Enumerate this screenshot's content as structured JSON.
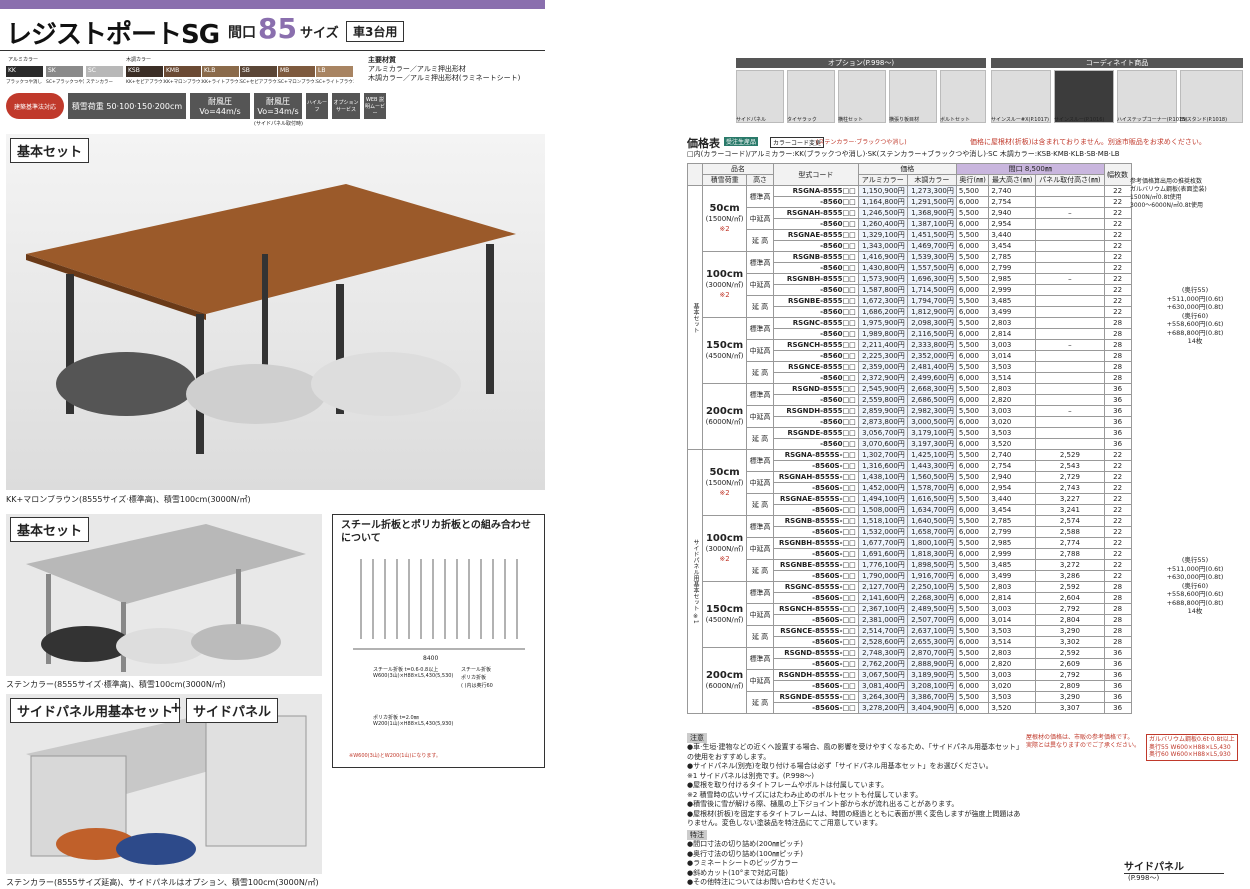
{
  "title": "レジストポートSG",
  "maguchi": "間口",
  "num": "85",
  "size": "サイズ",
  "cars": "車3台用",
  "colors_label": "アルミカラー",
  "wood_label": "木調カラー",
  "swatches": [
    {
      "code": "KK",
      "name": "ブラックつや消し",
      "color": "#2a2a2a"
    },
    {
      "code": "SK",
      "name": "SC+ブラックつや消し",
      "color": "#8a8a8a"
    },
    {
      "code": "SC",
      "name": "ステンカラー",
      "color": "#b8b8b8"
    },
    {
      "code": "KSB",
      "name": "KK+セピアブラウン",
      "color": "#3b2e26"
    },
    {
      "code": "KMB",
      "name": "KK+マロンブラウン",
      "color": "#6b4a34"
    },
    {
      "code": "KLB",
      "name": "KK+ライトブラウン",
      "color": "#8a6a4a"
    },
    {
      "code": "SB",
      "name": "SC+セピアブラウン",
      "color": "#5b4636"
    },
    {
      "code": "MB",
      "name": "SC+マロンブラウン",
      "color": "#7e5a3e"
    },
    {
      "code": "LB",
      "name": "SC+ライトブラウン",
      "color": "#a88462"
    }
  ],
  "material_title": "主要材質",
  "material_lines": [
    "アルミカラー／アルミ押出形材",
    "木調カラー／アルミ押出形材(ラミネートシート)"
  ],
  "icons": [
    "建築基準法対応",
    "積雪荷重 50·100·150·200cm",
    "耐風圧 Vo=44m/s",
    "耐風圧 Vo=34m/s",
    "ハイルーフ",
    "オプション サービス",
    "WEB 説明ムービー"
  ],
  "sidebrace_note": "(サイドパネル取付時)",
  "sec1": "基本セット",
  "cap1": "KK+マロンブラウン(8555サイズ·標準高)、積雪100cm(3000N/㎡)",
  "sec2": "基本セット",
  "cap2": "ステンカラー(8555サイズ·標準高)、積雪100cm(3000N/㎡)",
  "sec3a": "サイドパネル用基本セット",
  "plus": "+",
  "sec3b": "サイドパネル",
  "cap3": "ステンカラー(8555サイズ延高)、サイドパネルはオプション、積雪100cm(3000N/㎡)",
  "steel_title": "スチール折板とポリカ折板との組み合わせについて",
  "steel_w": "8400",
  "steel_lbl1": "スチール折板 t=0.6·0.8以上",
  "steel_lbl2": "W600(3山)×H88×L5,430(5,530)",
  "steel_lbl3": "スチール折板",
  "steel_lbl4": "ポリカ折板",
  "steel_lbl5": "( )内は奥行60",
  "poly_lbl1": "ポリカ折板 t=2.0㎜",
  "poly_lbl2": "W200(1山)×H88×L5,430(5,930)",
  "poly_note": "※W600(3山)とW200(1山)になります。",
  "opt_header": "オプション(P.998〜)",
  "coord_header": "コーディネイト商品",
  "opts": [
    "サイドパネル",
    "タイヤラック",
    "横柱セット",
    "横張り板目材",
    "ボルトセット",
    "サインスルー#X(P.1017)",
    "サインスルー(P.1016)",
    "ハイステップコーナー(P.1018)",
    "EVスタンド(P.1018)"
  ],
  "price_title": "価格表",
  "price_tag1": "受注生産品",
  "price_tag2": "カラーコード変更",
  "price_tag_note": "(ステンカラー·ブラックつや消し)",
  "price_warn": "価格に屋根材(折板)は含まれておりません。別途市販品をお求めください。",
  "color_line": "□内(カラーコード)/アルミカラー:KK(ブラックつや消し)·SK(ステンカラー+ブラックつや消し)·SC 木調カラー:KSB·KMB·KLB·SB·MB·LB",
  "headers": {
    "name": "品名",
    "load": "積雪荷重",
    "height": "高さ",
    "model": "型式コード",
    "price": "価格",
    "alu": "アルミカラー",
    "wood": "木調カラー",
    "maguchi": "間口 8,500㎜",
    "depth": "奥行(㎜)",
    "maxh": "最大高さ(㎜)",
    "panel": "パネル取付高さ(㎜)",
    "sheets": "幅枚数"
  },
  "group1": "基本セット",
  "group2": "サイドパネル用基本セット ※1",
  "rows": [
    [
      "50cm",
      "(1500N/㎡)",
      "※2",
      "標準高",
      "RSGNA-8555□□",
      "1,150,900円",
      "1,273,300円",
      "5,500",
      "2,740",
      "",
      "22"
    ],
    [
      "",
      "",
      "",
      "",
      "-8560□□",
      "1,164,800円",
      "1,291,500円",
      "6,000",
      "2,754",
      "",
      "22"
    ],
    [
      "",
      "",
      "",
      "中延高",
      "RSGNAH-8555□□",
      "1,246,500円",
      "1,368,900円",
      "5,500",
      "2,940",
      "–",
      "22"
    ],
    [
      "",
      "",
      "",
      "",
      "-8560□□",
      "1,260,400円",
      "1,387,100円",
      "6,000",
      "2,954",
      "",
      "22"
    ],
    [
      "",
      "",
      "",
      "延 高",
      "RSGNAE-8555□□",
      "1,329,100円",
      "1,451,500円",
      "5,500",
      "3,440",
      "",
      "22"
    ],
    [
      "",
      "",
      "",
      "",
      "-8560□□",
      "1,343,000円",
      "1,469,700円",
      "6,000",
      "3,454",
      "",
      "22"
    ],
    [
      "100cm",
      "(3000N/㎡)",
      "※2",
      "標準高",
      "RSGNB-8555□□",
      "1,416,900円",
      "1,539,300円",
      "5,500",
      "2,785",
      "",
      "22"
    ],
    [
      "",
      "",
      "",
      "",
      "-8560□□",
      "1,430,800円",
      "1,557,500円",
      "6,000",
      "2,799",
      "",
      "22"
    ],
    [
      "",
      "",
      "",
      "中延高",
      "RSGNBH-8555□□",
      "1,573,900円",
      "1,696,300円",
      "5,500",
      "2,985",
      "–",
      "22"
    ],
    [
      "",
      "",
      "",
      "",
      "-8560□□",
      "1,587,800円",
      "1,714,500円",
      "6,000",
      "2,999",
      "",
      "22"
    ],
    [
      "",
      "",
      "",
      "延 高",
      "RSGNBE-8555□□",
      "1,672,300円",
      "1,794,700円",
      "5,500",
      "3,485",
      "",
      "22"
    ],
    [
      "",
      "",
      "",
      "",
      "-8560□□",
      "1,686,200円",
      "1,812,900円",
      "6,000",
      "3,499",
      "",
      "22"
    ],
    [
      "150cm",
      "(4500N/㎡)",
      "",
      "標準高",
      "RSGNC-8555□□",
      "1,975,900円",
      "2,098,300円",
      "5,500",
      "2,803",
      "",
      "28"
    ],
    [
      "",
      "",
      "",
      "",
      "-8560□□",
      "1,989,800円",
      "2,116,500円",
      "6,000",
      "2,814",
      "",
      "28"
    ],
    [
      "",
      "",
      "",
      "中延高",
      "RSGNCH-8555□□",
      "2,211,400円",
      "2,333,800円",
      "5,500",
      "3,003",
      "–",
      "28"
    ],
    [
      "",
      "",
      "",
      "",
      "-8560□□",
      "2,225,300円",
      "2,352,000円",
      "6,000",
      "3,014",
      "",
      "28"
    ],
    [
      "",
      "",
      "",
      "延 高",
      "RSGNCE-8555□□",
      "2,359,000円",
      "2,481,400円",
      "5,500",
      "3,503",
      "",
      "28"
    ],
    [
      "",
      "",
      "",
      "",
      "-8560□□",
      "2,372,900円",
      "2,499,600円",
      "6,000",
      "3,514",
      "",
      "28"
    ],
    [
      "200cm",
      "(6000N/㎡)",
      "",
      "標準高",
      "RSGND-8555□□",
      "2,545,900円",
      "2,668,300円",
      "5,500",
      "2,803",
      "",
      "36"
    ],
    [
      "",
      "",
      "",
      "",
      "-8560□□",
      "2,559,800円",
      "2,686,500円",
      "6,000",
      "2,820",
      "",
      "36"
    ],
    [
      "",
      "",
      "",
      "中延高",
      "RSGNDH-8555□□",
      "2,859,900円",
      "2,982,300円",
      "5,500",
      "3,003",
      "–",
      "36"
    ],
    [
      "",
      "",
      "",
      "",
      "-8560□□",
      "2,873,800円",
      "3,000,500円",
      "6,000",
      "3,020",
      "",
      "36"
    ],
    [
      "",
      "",
      "",
      "延 高",
      "RSGNDE-8555□□",
      "3,056,700円",
      "3,179,100円",
      "5,500",
      "3,503",
      "",
      "36"
    ],
    [
      "",
      "",
      "",
      "",
      "-8560□□",
      "3,070,600円",
      "3,197,300円",
      "6,000",
      "3,520",
      "",
      "36"
    ],
    [
      "50cm",
      "(1500N/㎡)",
      "※2",
      "標準高",
      "RSGNA-8555S-□□",
      "1,302,700円",
      "1,425,100円",
      "5,500",
      "2,740",
      "2,529",
      "22"
    ],
    [
      "",
      "",
      "",
      "",
      "-8560S-□□",
      "1,316,600円",
      "1,443,300円",
      "6,000",
      "2,754",
      "2,543",
      "22"
    ],
    [
      "",
      "",
      "",
      "中延高",
      "RSGNAH-8555S-□□",
      "1,438,100円",
      "1,560,500円",
      "5,500",
      "2,940",
      "2,729",
      "22"
    ],
    [
      "",
      "",
      "",
      "",
      "-8560S-□□",
      "1,452,000円",
      "1,578,700円",
      "6,000",
      "2,954",
      "2,743",
      "22"
    ],
    [
      "",
      "",
      "",
      "延 高",
      "RSGNAE-8555S-□□",
      "1,494,100円",
      "1,616,500円",
      "5,500",
      "3,440",
      "3,227",
      "22"
    ],
    [
      "",
      "",
      "",
      "",
      "-8560S-□□",
      "1,508,000円",
      "1,634,700円",
      "6,000",
      "3,454",
      "3,241",
      "22"
    ],
    [
      "100cm",
      "(3000N/㎡)",
      "※2",
      "標準高",
      "RSGNB-8555S-□□",
      "1,518,100円",
      "1,640,500円",
      "5,500",
      "2,785",
      "2,574",
      "22"
    ],
    [
      "",
      "",
      "",
      "",
      "-8560S-□□",
      "1,532,000円",
      "1,658,700円",
      "6,000",
      "2,799",
      "2,588",
      "22"
    ],
    [
      "",
      "",
      "",
      "中延高",
      "RSGNBH-8555S-□□",
      "1,677,700円",
      "1,800,100円",
      "5,500",
      "2,985",
      "2,774",
      "22"
    ],
    [
      "",
      "",
      "",
      "",
      "-8560S-□□",
      "1,691,600円",
      "1,818,300円",
      "6,000",
      "2,999",
      "2,788",
      "22"
    ],
    [
      "",
      "",
      "",
      "延 高",
      "RSGNBE-8555S-□□",
      "1,776,100円",
      "1,898,500円",
      "5,500",
      "3,485",
      "3,272",
      "22"
    ],
    [
      "",
      "",
      "",
      "",
      "-8560S-□□",
      "1,790,000円",
      "1,916,700円",
      "6,000",
      "3,499",
      "3,286",
      "22"
    ],
    [
      "150cm",
      "(4500N/㎡)",
      "",
      "標準高",
      "RSGNC-8555S-□□",
      "2,127,700円",
      "2,250,100円",
      "5,500",
      "2,803",
      "2,592",
      "28"
    ],
    [
      "",
      "",
      "",
      "",
      "-8560S-□□",
      "2,141,600円",
      "2,268,300円",
      "6,000",
      "2,814",
      "2,604",
      "28"
    ],
    [
      "",
      "",
      "",
      "中延高",
      "RSGNCH-8555S-□□",
      "2,367,100円",
      "2,489,500円",
      "5,500",
      "3,003",
      "2,792",
      "28"
    ],
    [
      "",
      "",
      "",
      "",
      "-8560S-□□",
      "2,381,000円",
      "2,507,700円",
      "6,000",
      "3,014",
      "2,804",
      "28"
    ],
    [
      "",
      "",
      "",
      "延 高",
      "RSGNCE-8555S-□□",
      "2,514,700円",
      "2,637,100円",
      "5,500",
      "3,503",
      "3,290",
      "28"
    ],
    [
      "",
      "",
      "",
      "",
      "-8560S-□□",
      "2,528,600円",
      "2,655,300円",
      "6,000",
      "3,514",
      "3,302",
      "28"
    ],
    [
      "200cm",
      "(6000N/㎡)",
      "",
      "標準高",
      "RSGND-8555S-□□",
      "2,748,300円",
      "2,870,700円",
      "5,500",
      "2,803",
      "2,592",
      "36"
    ],
    [
      "",
      "",
      "",
      "",
      "-8560S-□□",
      "2,762,200円",
      "2,888,900円",
      "6,000",
      "2,820",
      "2,609",
      "36"
    ],
    [
      "",
      "",
      "",
      "中延高",
      "RSGNDH-8555S-□□",
      "3,067,500円",
      "3,189,900円",
      "5,500",
      "3,003",
      "2,792",
      "36"
    ],
    [
      "",
      "",
      "",
      "",
      "-8560S-□□",
      "3,081,400円",
      "3,208,100円",
      "6,000",
      "3,020",
      "2,809",
      "36"
    ],
    [
      "",
      "",
      "",
      "延 高",
      "RSGNDE-8555S-□□",
      "3,264,300円",
      "3,386,700円",
      "5,500",
      "3,503",
      "3,290",
      "36"
    ],
    [
      "",
      "",
      "",
      "",
      "-8560S-□□",
      "3,278,200円",
      "3,404,900円",
      "6,000",
      "3,520",
      "3,307",
      "36"
    ]
  ],
  "ref_title": "参考価格算出用の推奨枚数",
  "ref_lines": [
    "ガルバリウム鋼板(表面塗装)",
    "1500N/㎡0.8t使用",
    "3000〜6000N/㎡0.8t使用"
  ],
  "ref1": [
    "(奥行55)",
    "+511,000円(0.6t)",
    "+630,000円(0.8t)",
    "(奥行60)",
    "+558,600円(0.6t)",
    "+688,800円(0.8t)",
    "14枚"
  ],
  "ref2": [
    "(奥行55)",
    "+511,000円(0.6t)",
    "+630,000円(0.8t)",
    "(奥行60)",
    "+558,600円(0.6t)",
    "+688,800円(0.8t)",
    "14枚"
  ],
  "roof_note": [
    "屋根材の価格は、市販の参考価格です。",
    "実際とは異なりますのでご了承ください。"
  ],
  "galva_note": [
    "ガルバリウム鋼板0.6t·0.8t以上",
    "奥行55 W600×H88×L5,430",
    "奥行60 W600×H88×L5,930"
  ],
  "notes_title": "注意",
  "notes": [
    "●車·生垣·建物などの近くへ設置する場合、風の影響を受けやすくなるため、「サイドパネル用基本セット」の使用をおすすめします。",
    "●サイドパネル(別売)を取り付ける場合は必ず「サイドパネル用基本セット」をお選びください。",
    "※1 サイドパネルは別売です。(P.998〜)",
    "●屋根を取り付けるタイトフレームやボルトは付属しています。",
    "※2 積雪時の広いサイズにはたわみ止めのボルトセットも付属しています。",
    "●積雪後に雪が解ける際、樋風の上下ジョイント部から水が流れ出ることがあります。",
    "●屋根材(折板)を固定するタイトフレームは、時間の経過とともに表面が黒く変色しますが強度上問題はありません。変色しない塗装品を特注品にてご用意しています。"
  ],
  "tokuchu_title": "特注",
  "tokuchu": [
    "●間口寸法の切り詰め(200㎜ピッチ)",
    "●奥行寸法の切り詰め(100㎜ピッチ)",
    "●ラミネートシートのビッグカラー",
    "●斜めカット(10°まで対応可能)",
    "●その他特注についてはお問い合わせください。"
  ],
  "side_panel": "サイドパネル",
  "side_panel_ref": "(P.998〜)"
}
